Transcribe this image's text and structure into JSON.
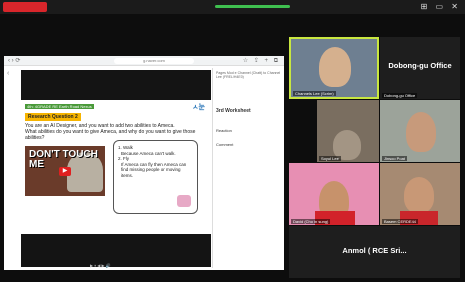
{
  "shared_screen": {
    "url": "g.naver.com",
    "slide": {
      "tag": "4th: 4GRADE RE Earth Road Nexus",
      "logo": "ㅅ눈",
      "section": "Research Question 2",
      "prompt_line1": "You are an AI Designer, and you want to add two abilities to Ameca.",
      "prompt_line2": "What abilities do you want to give Ameca, and why do you want to give those abilities?",
      "video_title": "DON'T TOUCH ME",
      "answer_lines": [
        "1. Walk",
        "Because Ameca can't walk.",
        "2. Fly",
        "If Ameca can fly then Ameca can find missing people or moving items."
      ]
    },
    "zoom_label": "▶ ⏸ ◀ ▶ 🔊"
  },
  "chat_panel": {
    "to_line": "Pages Mod e Channel (Chatt) to Channel Lee (FREL/H4E0)",
    "name": "3rd Worksheet",
    "items": [
      "Reaction",
      "Comment"
    ]
  },
  "participants": {
    "active_speaker": "Channels Lee (Scrim)",
    "dobong": "Dobong-gu Office",
    "dobong_small": "Dobong-gu Office",
    "soyul": "Soyul Lee",
    "jisoo": "Jinsoo Poat",
    "david": "David (Cho in sung)",
    "basem": "Basem CERDE44",
    "anmol": "Anmol ( RCE Sri..."
  }
}
